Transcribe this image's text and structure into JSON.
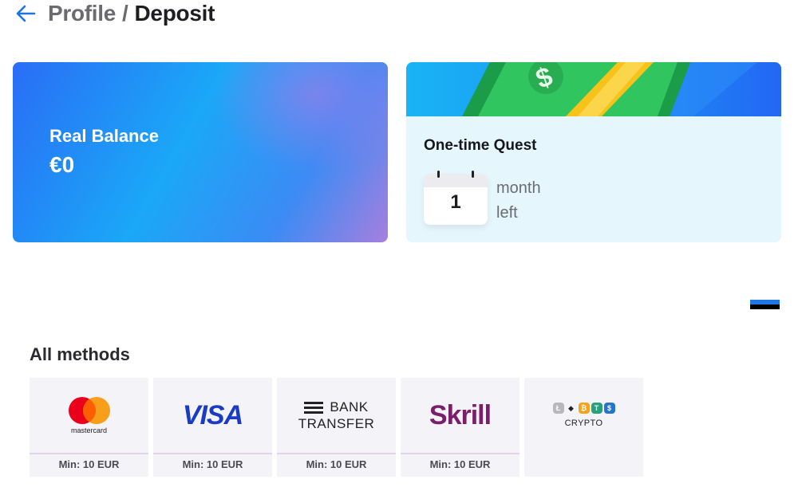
{
  "header": {
    "parent": "Profile",
    "separator": "/",
    "current": "Deposit"
  },
  "balance": {
    "label": "Real Balance",
    "value": "€0"
  },
  "quest": {
    "title": "One-time Quest",
    "calendar_number": "1",
    "time_unit": "month",
    "time_suffix": "left"
  },
  "methods": {
    "title": "All methods",
    "items": [
      {
        "name": "mastercard",
        "label": "mastercard",
        "min": "Min: 10 EUR"
      },
      {
        "name": "visa",
        "label": "VISA",
        "min": "Min: 10 EUR"
      },
      {
        "name": "bank-transfer",
        "label_line1": "BANK",
        "label_line2": "TRANSFER",
        "min": "Min: 10 EUR"
      },
      {
        "name": "skrill",
        "label": "Skrill",
        "min": "Min: 10 EUR"
      },
      {
        "name": "crypto",
        "label": "CRYPTO"
      }
    ]
  },
  "colors": {
    "accent": "#1a73e8",
    "mastercard_red": "#eb001b",
    "mastercard_yellow": "#f79e1b",
    "visa_blue": "#1a3bc4",
    "skrill_purple": "#7a1f6a"
  }
}
